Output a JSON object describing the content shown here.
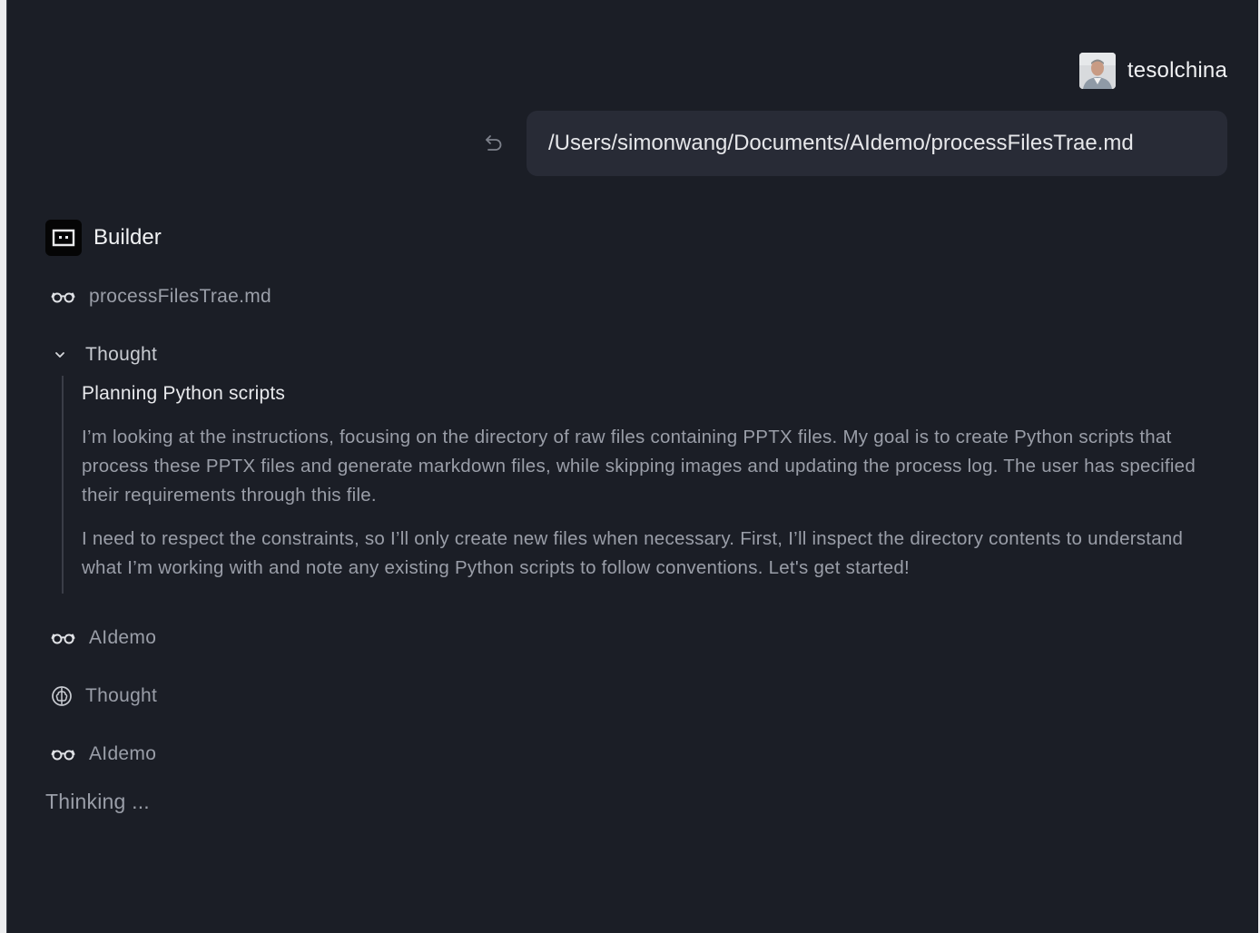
{
  "user": {
    "name": "tesolchina",
    "avatar_icon": "user-avatar-photo"
  },
  "message": {
    "text": "/Users/simonwang/Documents/AIdemo/processFilesTrae.md",
    "undo_icon": "undo-icon"
  },
  "agent": {
    "name": "Builder",
    "logo_icon": "builder-logo-icon"
  },
  "steps": {
    "read_file": {
      "icon": "glasses-icon",
      "label": "processFilesTrae.md"
    },
    "thought_expanded": {
      "icon": "chevron-down-icon",
      "label": "Thought",
      "title": "Planning Python scripts",
      "paragraphs": [
        "I’m looking at the instructions, focusing on the directory of raw files containing PPTX files. My goal is to create Python scripts that process these PPTX files and generate markdown files, while skipping images and updating the process log. The user has specified their requirements through this file.",
        "I need to respect the constraints, so I’ll only create new files when necessary. First, I’ll inspect the directory contents to understand what I’m working with and note any existing Python scripts to follow conventions. Let's get started!"
      ]
    },
    "read_dir_1": {
      "icon": "glasses-icon",
      "label": "AIdemo"
    },
    "thought_collapsed": {
      "icon": "brain-icon",
      "label": "Thought"
    },
    "read_dir_2": {
      "icon": "glasses-icon",
      "label": "AIdemo"
    }
  },
  "status": {
    "thinking": "Thinking ..."
  },
  "colors": {
    "background": "#1b1e26",
    "message_bubble": "#282b36",
    "muted_text": "#9a9ea8",
    "primary_text": "#f1f2f4"
  }
}
